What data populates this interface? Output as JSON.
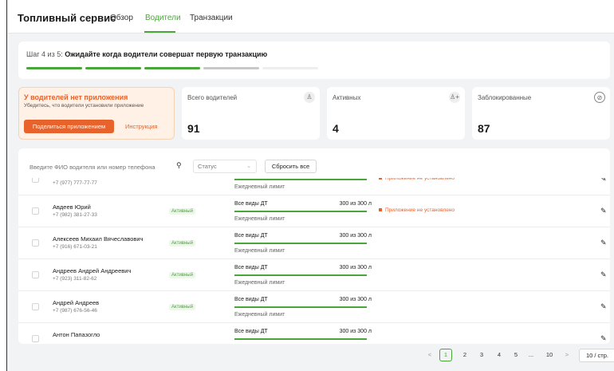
{
  "app": {
    "title": "Топливный сервис"
  },
  "nav": {
    "tabs": [
      {
        "label": "Обзор"
      },
      {
        "label": "Водители"
      },
      {
        "label": "Транзакции"
      }
    ],
    "active": 1
  },
  "onboarding": {
    "step_prefix": "Шаг 4 из 5:",
    "step_text": "Ожидайте когда водители совершат первую транзакцию",
    "steps": [
      {
        "status": "done"
      },
      {
        "status": "done"
      },
      {
        "status": "done"
      },
      {
        "status": "current"
      },
      {
        "status": "pending"
      }
    ],
    "colors": {
      "done": "#4aa63a",
      "current": "#c8c8c8",
      "pending": "#eeeeee"
    }
  },
  "app_warning": {
    "title": "У водителей нет приложения",
    "subtitle": "Убедитесь, что водители установили приложение",
    "share_button": "Поделиться приложением",
    "instruction_link": "Инструкция"
  },
  "stats": [
    {
      "label": "Всего водителей",
      "value": "91",
      "icon": "person-icon"
    },
    {
      "label": "Активных",
      "value": "4",
      "icon": "person-plus-icon"
    },
    {
      "label": "Заблокированные",
      "value": "87",
      "icon": "blocked-icon"
    }
  ],
  "filters": {
    "search_placeholder": "Введите ФИО водителя или номер телефона",
    "status_placeholder": "Статус",
    "reset_label": "Сбросить все"
  },
  "drivers": [
    {
      "name": "",
      "phone": "+7 (977) 777-77-77",
      "status": "",
      "fuel": "",
      "usage": "",
      "usage_fraction": 1.0,
      "limit": "Ежедневный лимит",
      "app_status": "Приложение не установлено"
    },
    {
      "name": "Авдеев Юрий",
      "phone": "+7 (982) 381-27-33",
      "status": "Активный",
      "fuel": "Все виды ДТ",
      "usage": "300 из 300 л",
      "usage_fraction": 1.0,
      "limit": "Ежедневный лимит",
      "app_status": "Приложение не установлено"
    },
    {
      "name": "Алексеев Михаил Вячеславович",
      "phone": "+7 (916) 671-03-21",
      "status": "Активный",
      "fuel": "Все виды ДТ",
      "usage": "300 из 300 л",
      "usage_fraction": 1.0,
      "limit": "Ежедневный лимит",
      "app_status": ""
    },
    {
      "name": "Андреев Андрей Андреевич",
      "phone": "+7 (923) 311-82-62",
      "status": "Активный",
      "fuel": "Все виды ДТ",
      "usage": "300 из 300 л",
      "usage_fraction": 1.0,
      "limit": "Ежедневный лимит",
      "app_status": ""
    },
    {
      "name": "Андрей Андреев",
      "phone": "+7 (987) 676-56-46",
      "status": "Активный",
      "fuel": "Все виды ДТ",
      "usage": "300 из 300 л",
      "usage_fraction": 1.0,
      "limit": "Ежедневный лимит",
      "app_status": ""
    },
    {
      "name": "Антон Папазогло",
      "phone": "",
      "status": "",
      "fuel": "Все виды ДТ",
      "usage": "300 из 300 л",
      "usage_fraction": 1.0,
      "limit": "",
      "app_status": ""
    }
  ],
  "pagination": {
    "prev": "<",
    "next": ">",
    "pages": [
      "1",
      "2",
      "3",
      "4",
      "5",
      "...",
      "10"
    ],
    "current": "1",
    "page_size": "10 / стр."
  },
  "colors": {
    "accent": "#4aa63a",
    "warning": "#e8622c"
  }
}
